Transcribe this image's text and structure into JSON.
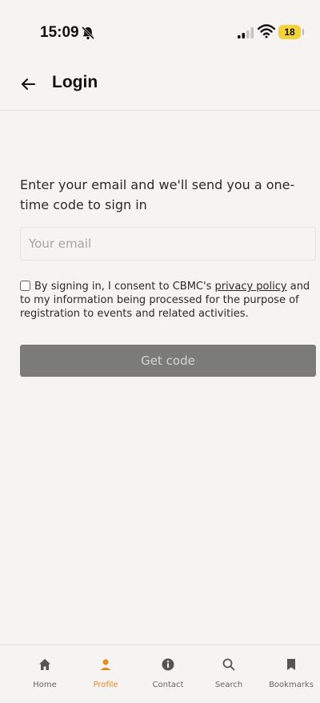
{
  "status_bar": {
    "time": "15:09",
    "battery": "18"
  },
  "header": {
    "title": "Login"
  },
  "form": {
    "intro": "Enter your email and we'll send you a one-time code to sign in",
    "email_placeholder": "Your email",
    "consent_prefix": "By signing in, I consent to CBMC's ",
    "privacy_link": "privacy policy",
    "consent_suffix": " and to my information being processed for the purpose of registration to events and related activities.",
    "button_label": "Get code"
  },
  "nav": {
    "items": [
      {
        "label": "Home",
        "icon": "home-icon"
      },
      {
        "label": "Profile",
        "icon": "profile-icon",
        "active": true
      },
      {
        "label": "Contact",
        "icon": "info-icon"
      },
      {
        "label": "Search",
        "icon": "search-icon"
      },
      {
        "label": "Bookmarks",
        "icon": "bookmark-icon"
      }
    ],
    "active_color": "#e58a1c",
    "inactive_color": "#666666"
  }
}
